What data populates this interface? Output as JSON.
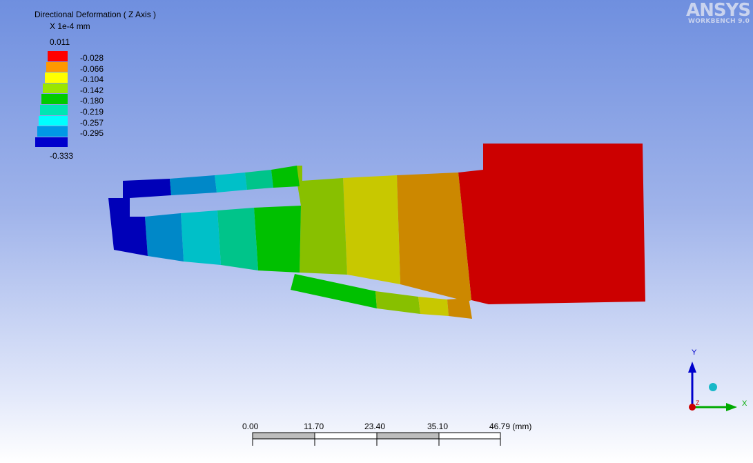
{
  "legend": {
    "title": "Directional Deformation ( Z Axis )",
    "units": "X 1e-4 mm",
    "max_label": "0.011",
    "min_label": "-0.333",
    "bands": [
      {
        "label": "-0.028",
        "color": "#ff0000"
      },
      {
        "label": "-0.066",
        "color": "#ff9900"
      },
      {
        "label": "-0.104",
        "color": "#ffff00"
      },
      {
        "label": "-0.142",
        "color": "#99e600"
      },
      {
        "label": "-0.180",
        "color": "#00cc00"
      },
      {
        "label": "-0.219",
        "color": "#00e6b3"
      },
      {
        "label": "-0.257",
        "color": "#00ffff"
      },
      {
        "label": "-0.295",
        "color": "#0099e6"
      },
      {
        "label": "",
        "color": "#0000cc"
      }
    ]
  },
  "logo": {
    "brand": "ANSYS",
    "product": "WORKBENCH 9.0"
  },
  "scale": {
    "labels": [
      "0.00",
      "11.70",
      "23.40",
      "35.10",
      "46.79 (mm)"
    ]
  },
  "triad": {
    "x_label": "X",
    "y_label": "Y",
    "z_label": "Z"
  },
  "colors": {
    "red": "#cc0000",
    "orange": "#cc8800",
    "yellow": "#c8c800",
    "yellowgreen": "#88c000",
    "green": "#00c000",
    "teal": "#00c48a",
    "cyan": "#00c0c8",
    "lightblue": "#0088c8",
    "blue": "#0000b8"
  }
}
